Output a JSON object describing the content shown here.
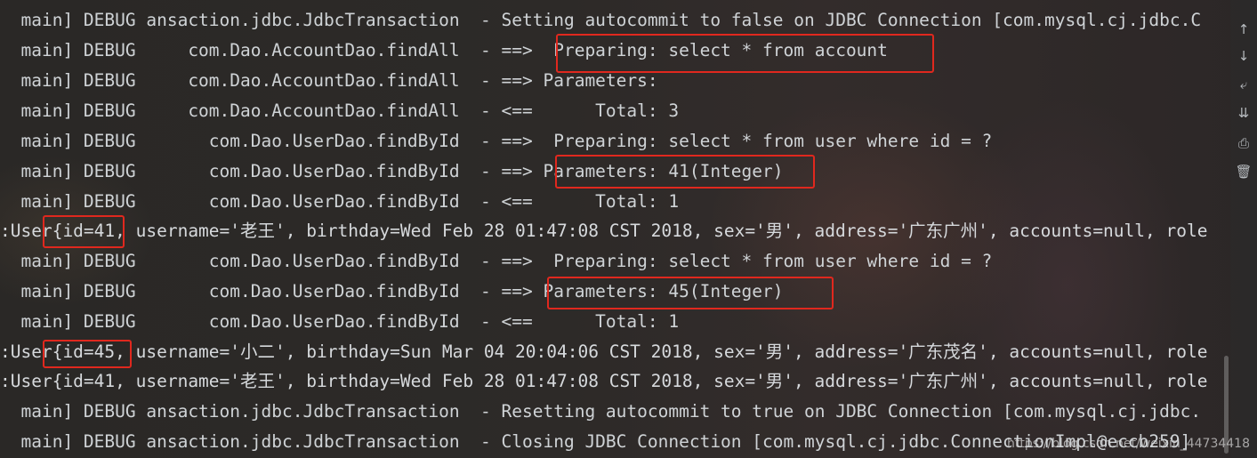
{
  "log": {
    "lines": [
      "  main] DEBUG ansaction.jdbc.JdbcTransaction  - Setting autocommit to false on JDBC Connection [com.mysql.cj.jdbc.C",
      "  main] DEBUG     com.Dao.AccountDao.findAll  - ==>  Preparing: select * from account",
      "  main] DEBUG     com.Dao.AccountDao.findAll  - ==> Parameters: ",
      "  main] DEBUG     com.Dao.AccountDao.findAll  - <==      Total: 3",
      "  main] DEBUG       com.Dao.UserDao.findById  - ==>  Preparing: select * from user where id = ?",
      "  main] DEBUG       com.Dao.UserDao.findById  - ==> Parameters: 41(Integer)",
      "  main] DEBUG       com.Dao.UserDao.findById  - <==      Total: 1",
      ":User{id=41, username='老王', birthday=Wed Feb 28 01:47:08 CST 2018, sex='男', address='广东广州', accounts=null, role",
      "  main] DEBUG       com.Dao.UserDao.findById  - ==>  Preparing: select * from user where id = ?",
      "  main] DEBUG       com.Dao.UserDao.findById  - ==> Parameters: 45(Integer)",
      "  main] DEBUG       com.Dao.UserDao.findById  - <==      Total: 1",
      ":User{id=45, username='小二', birthday=Sun Mar 04 20:04:06 CST 2018, sex='男', address='广东茂名', accounts=null, role",
      ":User{id=41, username='老王', birthday=Wed Feb 28 01:47:08 CST 2018, sex='男', address='广东广州', accounts=null, role",
      "  main] DEBUG ansaction.jdbc.JdbcTransaction  - Resetting autocommit to true on JDBC Connection [com.mysql.cj.jdbc.",
      "  main] DEBUG ansaction.jdbc.JdbcTransaction  - Closing JDBC Connection [com.mysql.cj.jdbc.ConnectionImpl@eccb259]"
    ]
  },
  "toolbar": {
    "icons": [
      "arrow-up-icon",
      "arrow-down-icon",
      "soft-wrap-icon",
      "scroll-to-end-icon",
      "print-icon",
      "trash-icon"
    ],
    "glyphs": [
      "↑",
      "↓",
      "⤶",
      "⇊",
      "⎙",
      "🗑"
    ]
  },
  "watermark": "https://blog.csdn.net/weixin_44734418",
  "colors": {
    "background": "#2b2b2b",
    "text": "#cfd3d6",
    "highlight_box": "#e0281e"
  }
}
